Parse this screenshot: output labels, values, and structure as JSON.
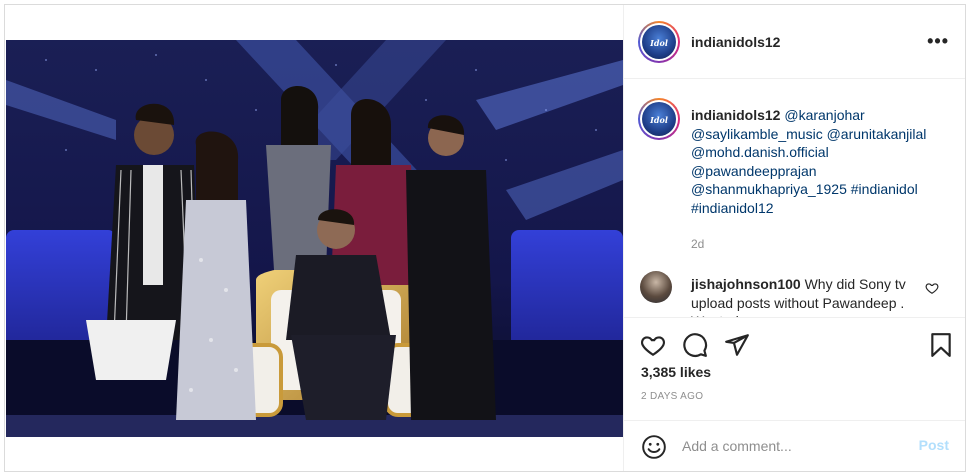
{
  "post": {
    "username": "indianidols12",
    "avatar_text": "Idol",
    "more_icon": "more-horizontal-icon",
    "caption": {
      "username": "indianidols12",
      "mentions": [
        "@karanjohar",
        "@saylikamble_music",
        "@arunitakanjilal",
        "@mohd.danish.official",
        "@pawandeepprajan",
        "@shanmukhapriya_1925"
      ],
      "hashtags": [
        "#indianidol",
        "#indianidol12"
      ],
      "time": "2d"
    },
    "comment": {
      "username": "jishajohnson100",
      "text": "Why did Sony tv upload posts without Pawandeep . Wanted"
    },
    "likes": "3,385 likes",
    "posted_ago": "2 DAYS AGO",
    "add_comment": {
      "placeholder": "Add a comment...",
      "post_label": "Post"
    },
    "colors": {
      "link": "#00376b",
      "muted": "#8e8e8e",
      "post_disabled": "#b2dffc",
      "border": "#efefef"
    }
  }
}
